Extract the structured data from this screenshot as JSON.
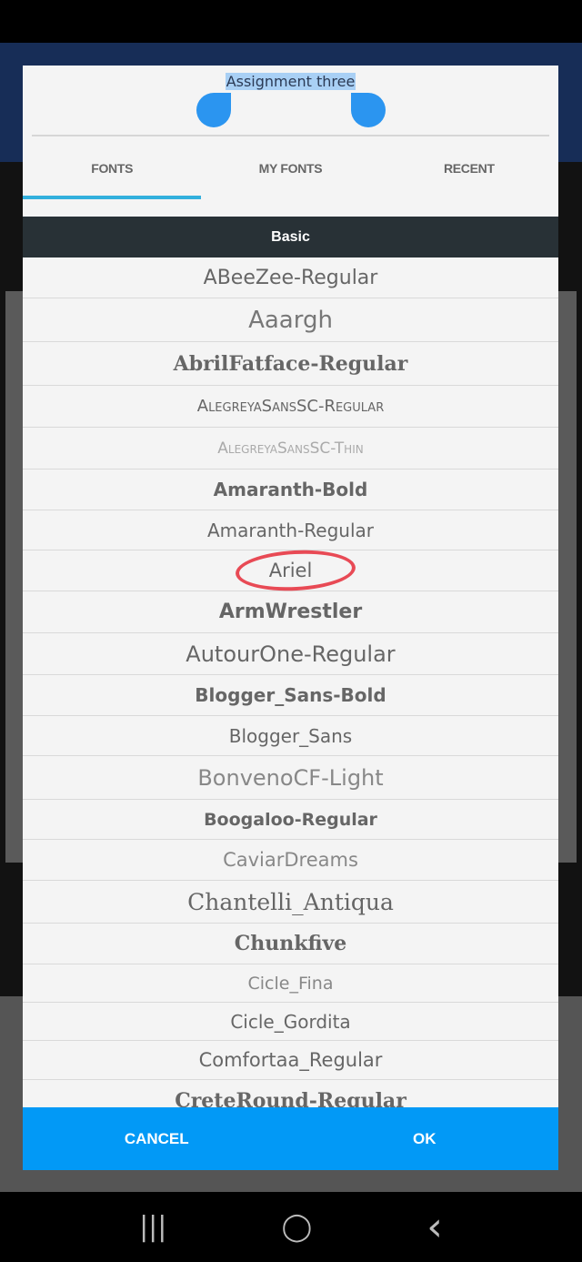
{
  "dialog": {
    "title": "Assignment three",
    "tabs": [
      {
        "label": "FONTS",
        "active": true
      },
      {
        "label": "MY FONTS"
      },
      {
        "label": "RECENT"
      }
    ],
    "section_header": "Basic",
    "fonts": [
      "ABeeZee-Regular",
      "Aaargh",
      "AbrilFatface-Regular",
      "AlegreyaSansSC-Regular",
      "AlegreyaSansSC-Thin",
      "Amaranth-Bold",
      "Amaranth-Regular",
      "Ariel",
      "ArmWrestler",
      "AutourOne-Regular",
      "Blogger_Sans-Bold",
      "Blogger_Sans",
      "BonvenoCF-Light",
      "Boogaloo-Regular",
      "CaviarDreams",
      "Chantelli_Antiqua",
      "Chunkfive",
      "Cicle_Fina",
      "Cicle_Gordita",
      "Comfortaa_Regular",
      "CreteRound-Regular"
    ],
    "highlighted_font": "Ariel",
    "cancel_label": "CANCEL",
    "ok_label": "OK"
  },
  "colors": {
    "accent": "#0299f6",
    "header": "#283136",
    "highlight_ring": "#e84a55",
    "tab_indicator": "#33b0dd"
  },
  "navbar": {
    "recents": "|||",
    "home": "◯",
    "back": "‹"
  }
}
